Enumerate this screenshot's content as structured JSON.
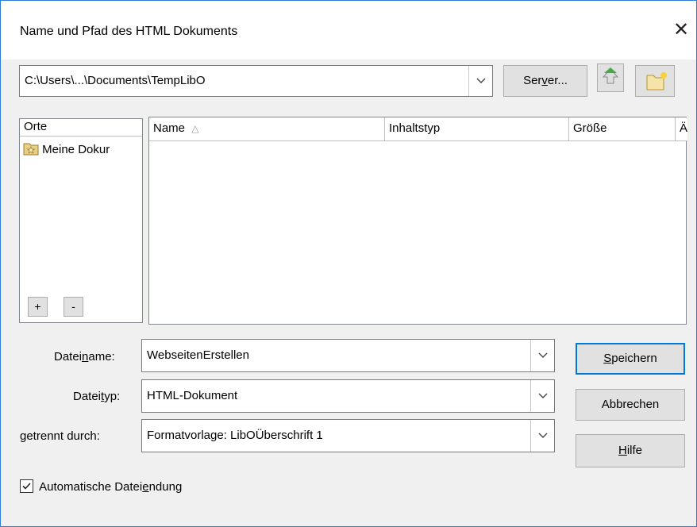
{
  "window": {
    "title": "Name und Pfad des HTML Dokuments",
    "close_glyph": "✕"
  },
  "path_bar": {
    "value": "C:\\Users\\...\\Documents\\TempLibO",
    "server_button_pre": "Ser",
    "server_button_mnemonic": "v",
    "server_button_post": "er...",
    "up_icon": "folder-up-icon",
    "new_folder_icon": "new-folder-icon"
  },
  "places": {
    "header": "Orte",
    "items": [
      {
        "label": "Meine Dokur",
        "icon": "favorites-folder-icon"
      }
    ],
    "add_label": "+",
    "remove_label": "-"
  },
  "file_list": {
    "columns": [
      "Name",
      "Inhaltstyp",
      "Größe",
      "Ä"
    ],
    "sort_indicator": "△",
    "rows": []
  },
  "form": {
    "filename_label_pre": "Datei",
    "filename_label_mnemonic": "n",
    "filename_label_post": "ame:",
    "filename_value": "WebseitenErstellen",
    "filetype_label_pre": "Datei",
    "filetype_label_mnemonic": "t",
    "filetype_label_post": "yp:",
    "filetype_value": "HTML-Dokument",
    "separated_label_mnemonic": "g",
    "separated_label_post": "etrennt durch:",
    "separated_value": "Formatvorlage: LibOÜberschrift 1"
  },
  "buttons": {
    "save_mnemonic": "S",
    "save_post": "peichern",
    "cancel": "Abbrechen",
    "help_mnemonic": "H",
    "help_post": "ilfe"
  },
  "auto_extension": {
    "checked": true,
    "label_pre": "Automatische Datei",
    "label_mnemonic": "e",
    "label_post": "ndung"
  },
  "colors": {
    "accent": "#0078d7",
    "window_border": "#2b7dd8",
    "button_face": "#e1e1e1"
  }
}
